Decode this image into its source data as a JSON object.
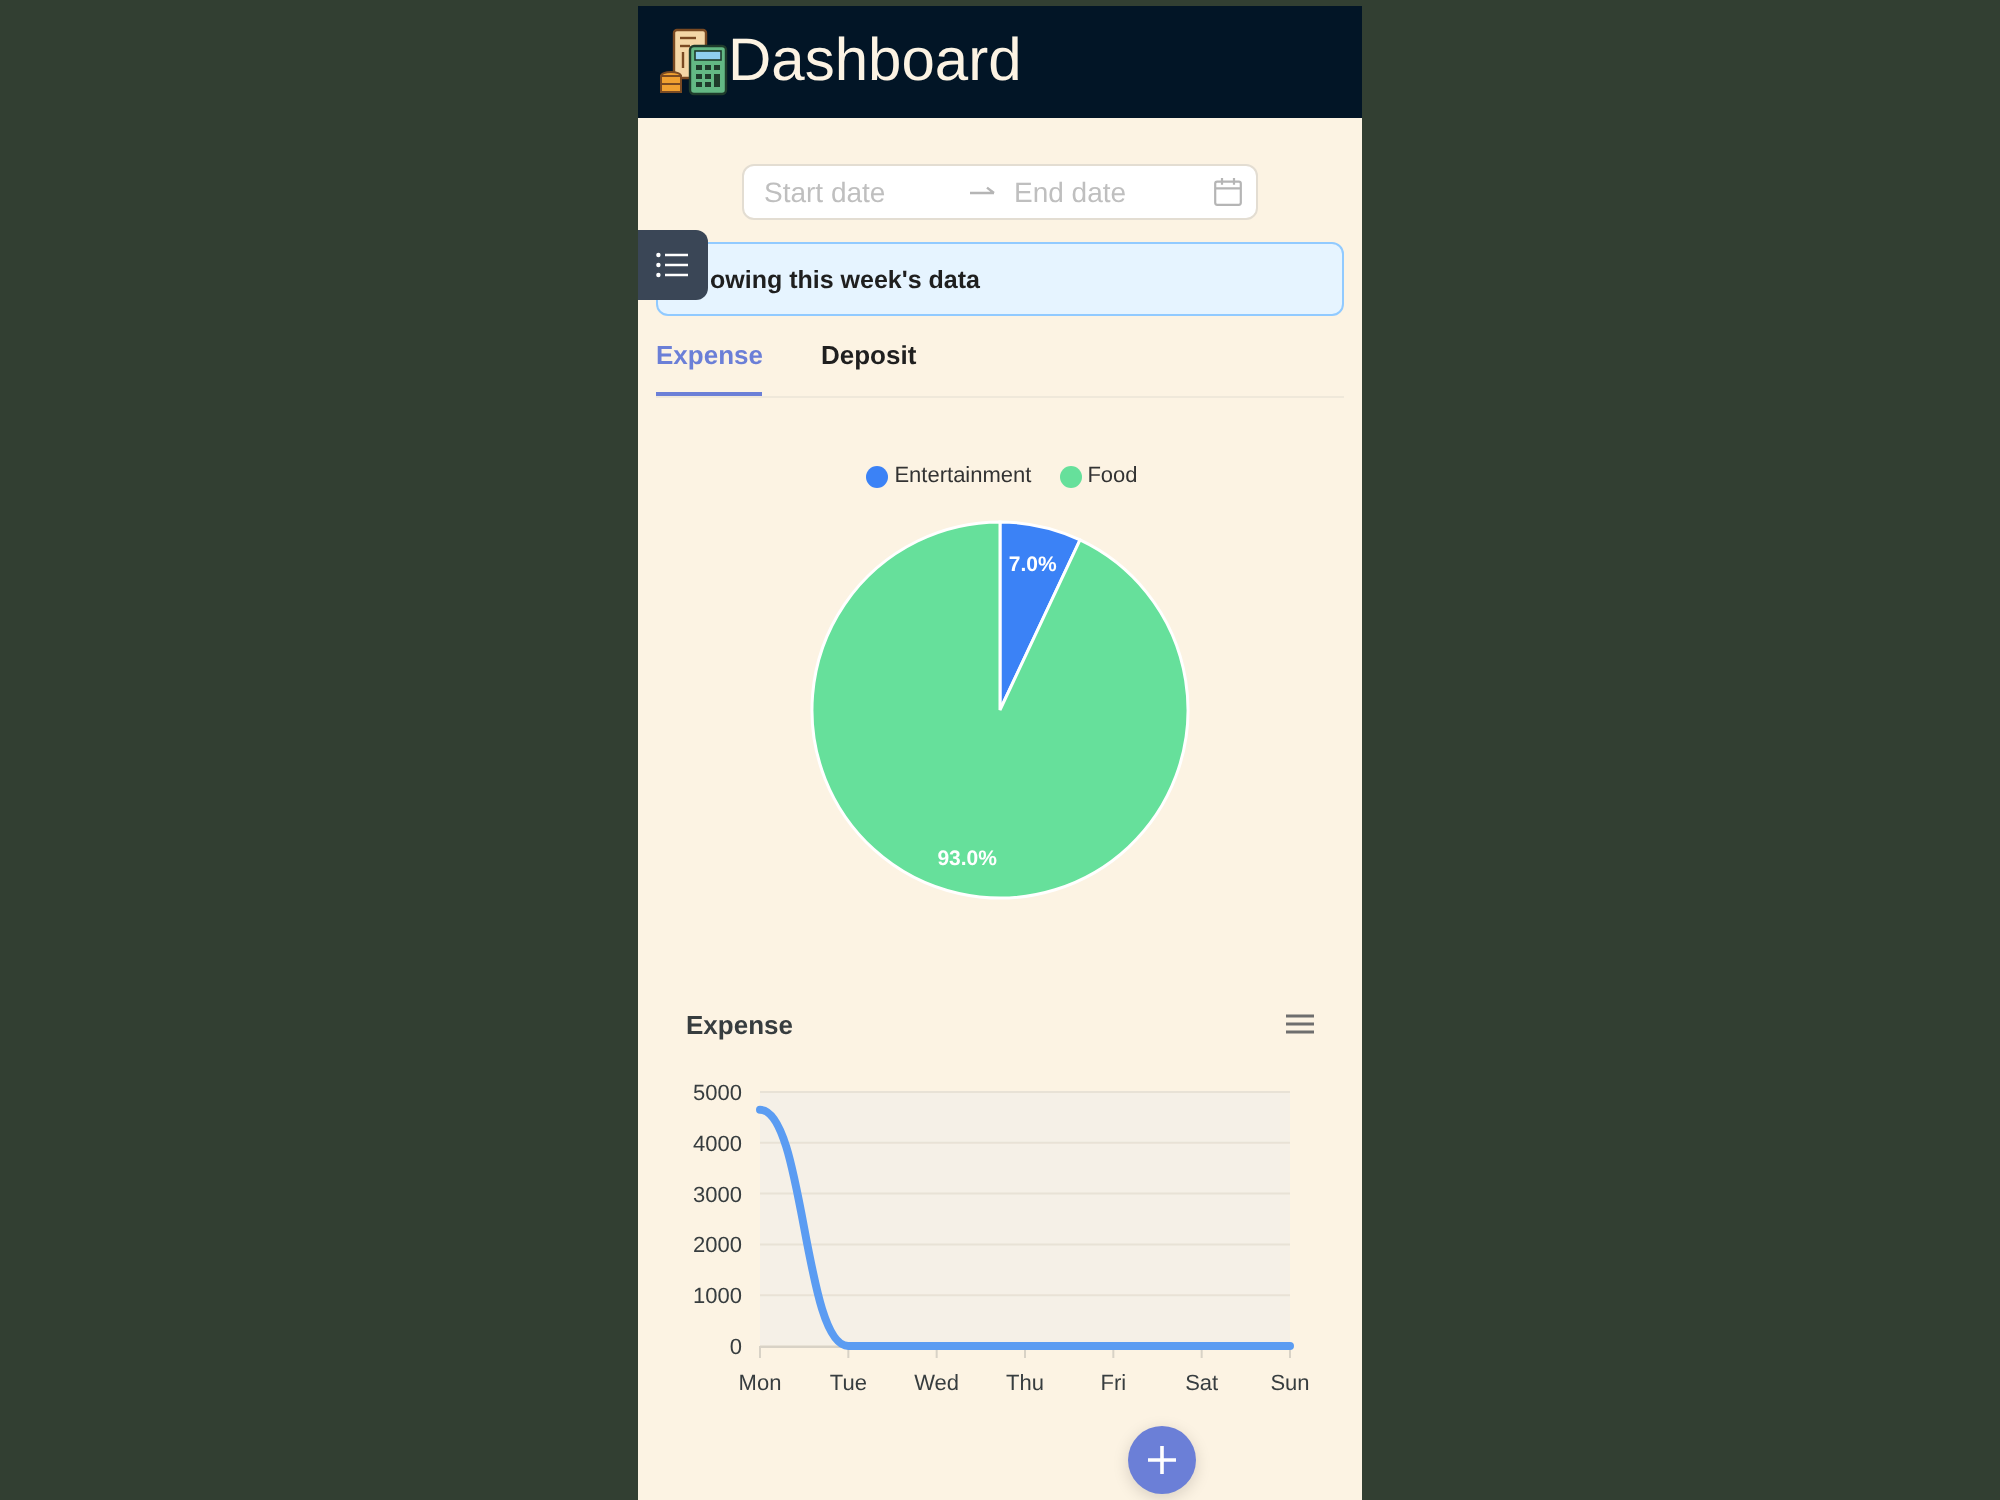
{
  "header": {
    "title": "Dashboard"
  },
  "date_range": {
    "start_placeholder": "Start date",
    "end_placeholder": "End date"
  },
  "alert": {
    "text": "owing this week's data"
  },
  "tabs": [
    {
      "label": "Expense",
      "selected": true
    },
    {
      "label": "Deposit",
      "selected": false
    }
  ],
  "pie": {
    "chart_data": {
      "type": "pie",
      "categories": [
        "Entertainment",
        "Food"
      ],
      "values": [
        7.0,
        93.0
      ],
      "colors": [
        "#3b82f6",
        "#66e09b"
      ],
      "value_labels": [
        "7.0%",
        "93.0%"
      ],
      "legend": "top"
    }
  },
  "line_chart": {
    "chart_data": {
      "type": "line",
      "title": "Expense",
      "categories": [
        "Mon",
        "Tue",
        "Wed",
        "Thu",
        "Fri",
        "Sat",
        "Sun"
      ],
      "values": [
        4650,
        0,
        0,
        0,
        0,
        0,
        0
      ],
      "ylim": [
        0,
        5000
      ],
      "yticks": [
        0,
        1000,
        2000,
        3000,
        4000,
        5000
      ],
      "grid": true
    }
  }
}
